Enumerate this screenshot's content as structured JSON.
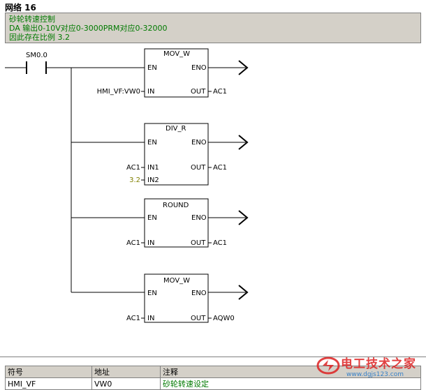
{
  "network": {
    "title": "网络 16"
  },
  "comment": {
    "line1": "砂轮转速控制",
    "line2": "DA 输出0-10V对应0-3000PRM对应0-32000",
    "line3": "因此存在比例 3.2"
  },
  "contact": {
    "label": "SM0.0"
  },
  "blocks": [
    {
      "name": "MOV_W",
      "en": "EN",
      "eno": "ENO",
      "inputs": [
        {
          "pin": "IN",
          "operand": "HMI_VF:VW0"
        }
      ],
      "out_pin": "OUT",
      "out_operand": "AC1"
    },
    {
      "name": "DIV_R",
      "en": "EN",
      "eno": "ENO",
      "inputs": [
        {
          "pin": "IN1",
          "operand": "AC1"
        },
        {
          "pin": "IN2",
          "operand": "3.2"
        }
      ],
      "out_pin": "OUT",
      "out_operand": "AC1"
    },
    {
      "name": "ROUND",
      "en": "EN",
      "eno": "ENO",
      "inputs": [
        {
          "pin": "IN",
          "operand": "AC1"
        }
      ],
      "out_pin": "OUT",
      "out_operand": "AC1"
    },
    {
      "name": "MOV_W",
      "en": "EN",
      "eno": "ENO",
      "inputs": [
        {
          "pin": "IN",
          "operand": "AC1"
        }
      ],
      "out_pin": "OUT",
      "out_operand": "AQW0"
    }
  ],
  "symbol_table": {
    "headers": [
      "符号",
      "地址",
      "注释"
    ],
    "rows": [
      [
        "HMI_VF",
        "VW0",
        "砂轮转速设定"
      ]
    ]
  },
  "watermark": {
    "brand": "电工技术之家",
    "url": "www.dgjs123.com"
  },
  "colors": {
    "comment_text": "#007a00",
    "constant_operand": "#808000",
    "panel_bg": "#d4d0c8"
  }
}
